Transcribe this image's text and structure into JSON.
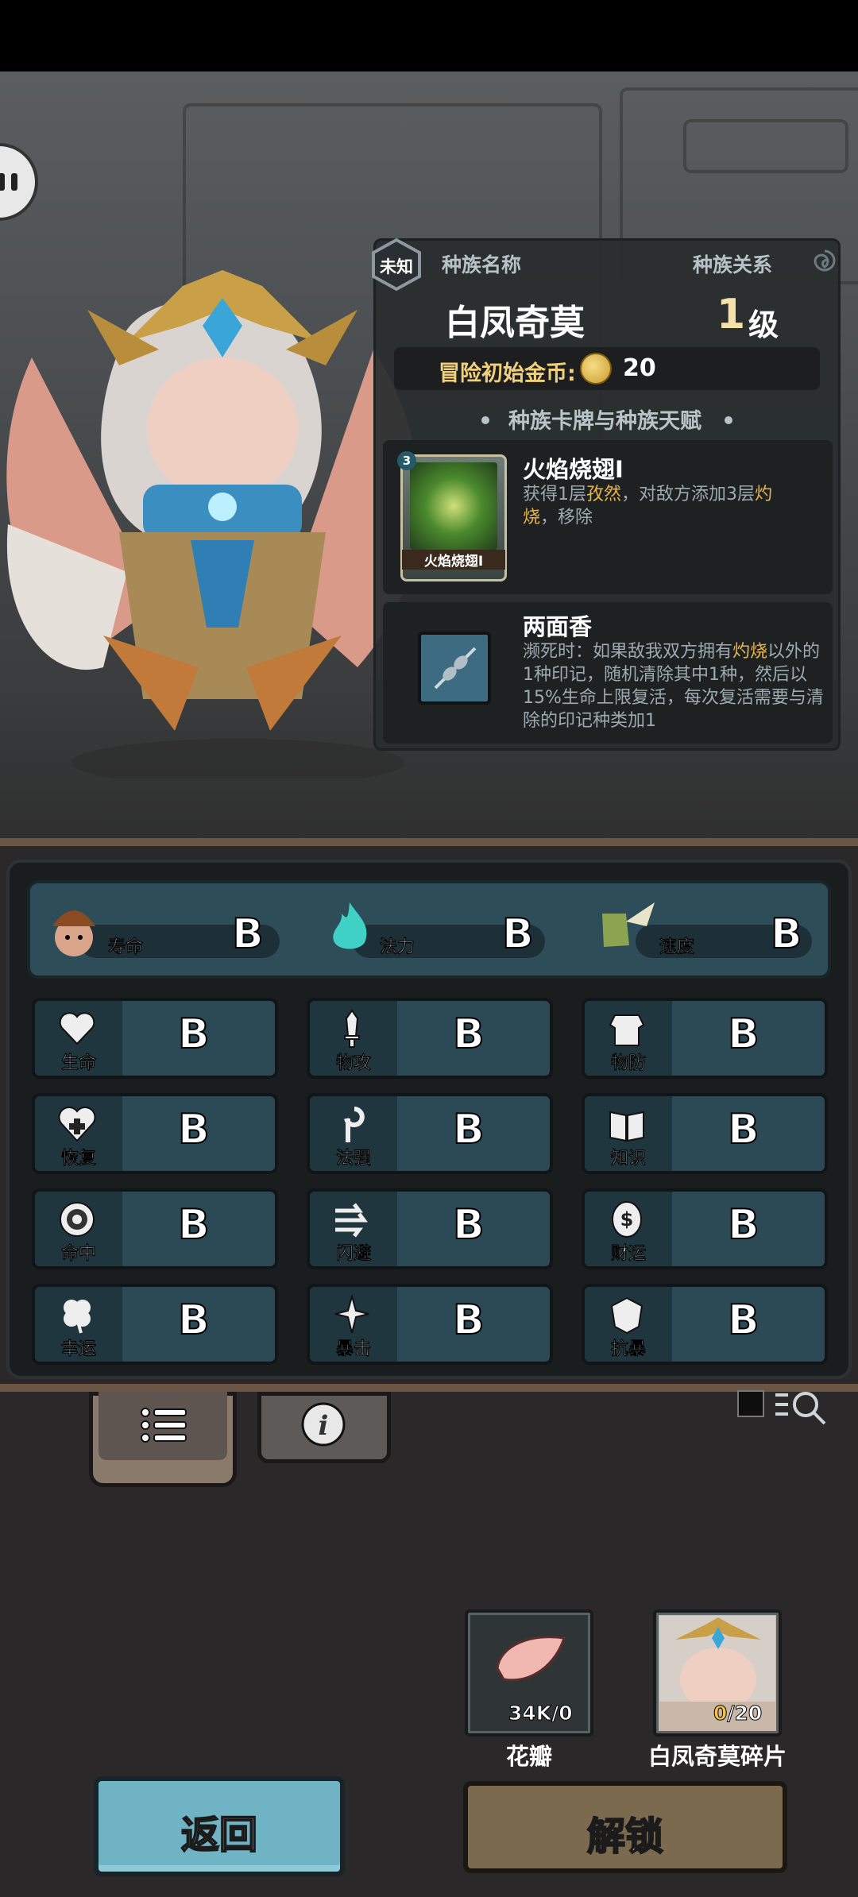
{
  "info_panel": {
    "unknown_badge": "未知",
    "race_name_header": "种族名称",
    "race_relation_header": "种族关系",
    "race_name": "白凤奇莫",
    "level_number": "1",
    "level_unit": "级",
    "start_gold_label": "冒险初始金币:",
    "start_gold_value": "20",
    "section_title": "种族卡牌与种族天赋",
    "card": {
      "cost": "3",
      "thumb_label": "火焰烧翅I",
      "name": "火焰烧翅I",
      "desc_1": "获得1层",
      "desc_2": "孜然",
      "desc_3": "，对敌方添加3层",
      "desc_4": "灼",
      "desc_5": "烧",
      "desc_6": "，移除"
    },
    "talent": {
      "name": "两面香",
      "desc_1": "濒死时：如果敌我双方拥有",
      "desc_2": "灼烧",
      "desc_3": "以外的1种印记，随机清除其中1种，然后以15%生命上限复活，每次复活需要与清除的印记种类加1"
    }
  },
  "top_stats": [
    {
      "label": "寿命",
      "grade": "B",
      "icon": "mushroom-head-icon"
    },
    {
      "label": "法力",
      "grade": "B",
      "icon": "blue-flame-icon"
    },
    {
      "label": "速度",
      "grade": "B",
      "icon": "winged-boot-icon"
    }
  ],
  "stats": [
    {
      "label": "生命",
      "grade": "B",
      "icon": "heart-icon"
    },
    {
      "label": "物攻",
      "grade": "B",
      "icon": "sword-icon"
    },
    {
      "label": "物防",
      "grade": "B",
      "icon": "armor-icon"
    },
    {
      "label": "恢复",
      "grade": "B",
      "icon": "heart-plus-icon"
    },
    {
      "label": "法强",
      "grade": "B",
      "icon": "staff-icon"
    },
    {
      "label": "知识",
      "grade": "B",
      "icon": "book-icon"
    },
    {
      "label": "命中",
      "grade": "B",
      "icon": "target-icon"
    },
    {
      "label": "闪避",
      "grade": "B",
      "icon": "dodge-arrows-icon"
    },
    {
      "label": "财运",
      "grade": "B",
      "icon": "coin-icon"
    },
    {
      "label": "幸运",
      "grade": "B",
      "icon": "clover-icon"
    },
    {
      "label": "暴击",
      "grade": "B",
      "icon": "crit-burst-icon"
    },
    {
      "label": "抗暴",
      "grade": "B",
      "icon": "shield-burst-icon"
    }
  ],
  "resources": {
    "petal": {
      "count": "34K/0",
      "name": "花瓣"
    },
    "shard": {
      "count_have": "0",
      "count_need": "/20",
      "name": "白凤奇莫碎片"
    }
  },
  "buttons": {
    "back": "返回",
    "unlock": "解锁"
  },
  "colors": {
    "highlight": "#e8b34a",
    "cell_bg": "#2b4a56",
    "back_button": "#6fb3c4",
    "unlock_button": "#7b6a4e"
  }
}
